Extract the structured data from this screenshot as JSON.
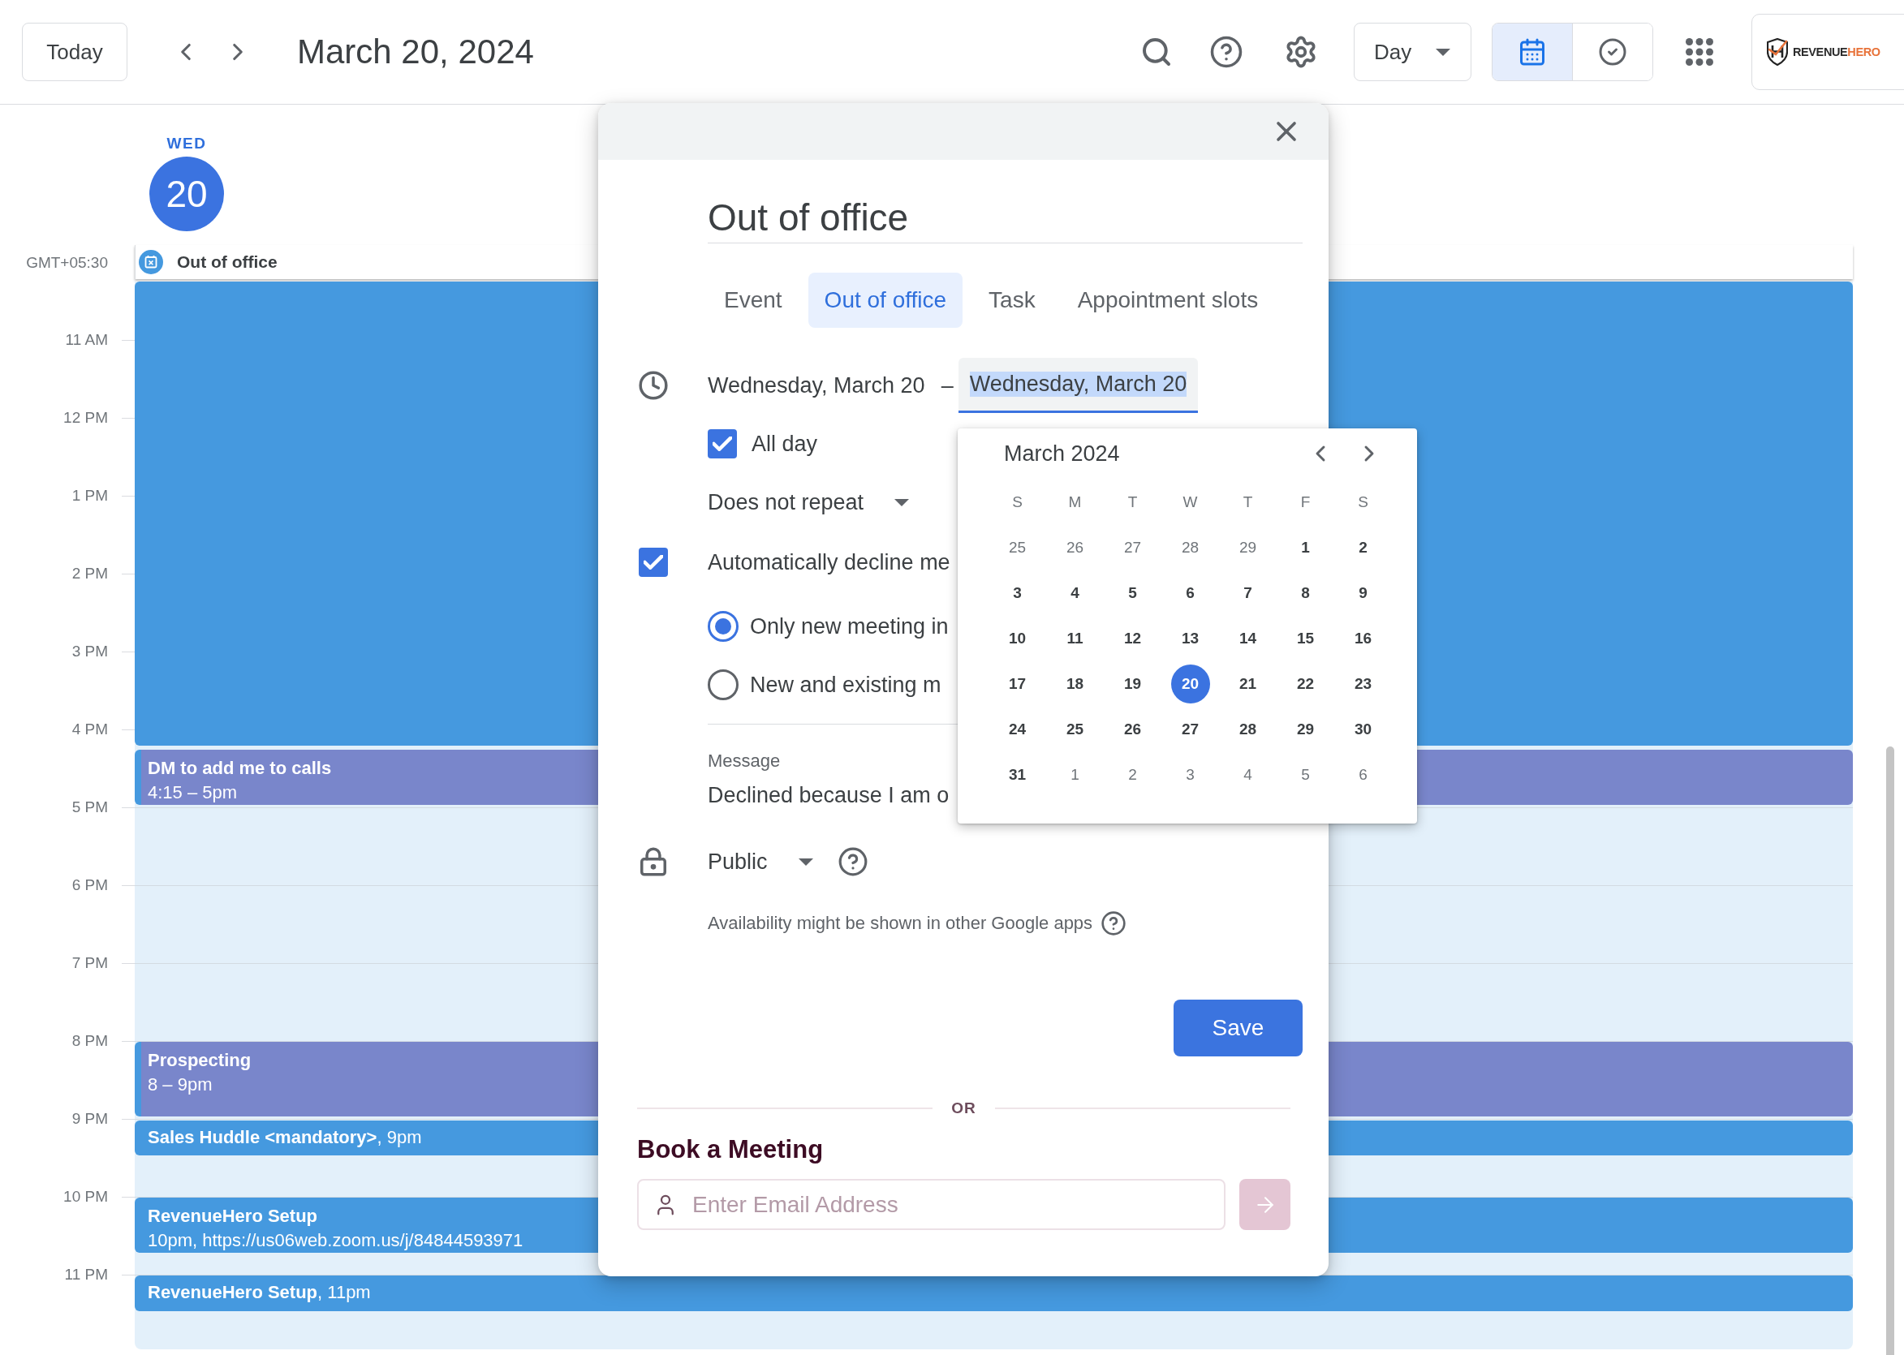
{
  "toolbar": {
    "today_button": "Today",
    "date_title": "March 20, 2024",
    "view_select": "Day",
    "view_toggle": [
      {
        "kind": "calendar",
        "selected": true
      },
      {
        "kind": "tasks",
        "selected": false
      }
    ],
    "logo": {
      "words": [
        {
          "text": "REVENUE",
          "color": "#2b2b2b"
        },
        {
          "text": "HERO",
          "color": "#e8733a"
        }
      ]
    }
  },
  "day_header": {
    "weekday": "WED",
    "date": "20",
    "today": true
  },
  "all_day": {
    "timezone": "GMT+05:30",
    "event": "Out of office"
  },
  "hours": [
    "11 AM",
    "12 PM",
    "1 PM",
    "2 PM",
    "3 PM",
    "4 PM",
    "5 PM",
    "6 PM",
    "7 PM",
    "8 PM",
    "9 PM",
    "10 PM",
    "11 PM"
  ],
  "events": [
    {
      "kind": "block",
      "color": "#4599df"
    },
    {
      "kind": "two_line",
      "title": "DM to add me to calls",
      "details": "4:15 – 5pm",
      "color": "#7986cb"
    },
    {
      "kind": "two_line",
      "title": "Prospecting",
      "details": "8 – 9pm",
      "color": "#7986cb"
    },
    {
      "kind": "one_line",
      "text": "**Sales Huddle <mandatory>**, 9pm",
      "color": "#4599df"
    },
    {
      "kind": "two_line",
      "title": "RevenueHero Setup",
      "details": "10pm, https://us06web.zoom.us/j/84844593971",
      "color": "#4599df"
    },
    {
      "kind": "one_line",
      "text": "**RevenueHero Setup**, 11pm",
      "color": "#4599df"
    }
  ],
  "dialog": {
    "title_field": "Out of office",
    "tabs": [
      {
        "label": "Event",
        "selected": false
      },
      {
        "label": "Out of office",
        "selected": true
      },
      {
        "label": "Task",
        "selected": false
      },
      {
        "label": "Appointment slots",
        "selected": false
      }
    ],
    "start_date": "Wednesday, March 20",
    "separator": "–",
    "end_date": {
      "value": "Wednesday, March 20",
      "focused": true
    },
    "all_day": {
      "label": "All day",
      "checked": true
    },
    "repeat": "Does not repeat",
    "auto_decline": {
      "label": "Automatically decline me",
      "checked": true
    },
    "decline_options": [
      {
        "label": "Only new meeting in",
        "selected": true
      },
      {
        "label": "New and existing m",
        "selected": false
      }
    ],
    "message": {
      "label": "Message",
      "value": "Declined because I am o"
    },
    "visibility": "Public",
    "availability_note": "Availability might be shown in other Google apps",
    "save_button": "Save",
    "divider_label": "OR",
    "booking": {
      "heading": "Book a Meeting",
      "email_placeholder": "Enter Email Address"
    }
  },
  "date_picker": {
    "title": "March 2024",
    "weekdays": [
      "S",
      "M",
      "T",
      "W",
      "T",
      "F",
      "S"
    ],
    "days": [
      {
        "label": "25",
        "in_month": false,
        "selected": false
      },
      {
        "label": "26",
        "in_month": false,
        "selected": false
      },
      {
        "label": "27",
        "in_month": false,
        "selected": false
      },
      {
        "label": "28",
        "in_month": false,
        "selected": false
      },
      {
        "label": "29",
        "in_month": false,
        "selected": false
      },
      {
        "label": "1",
        "in_month": true,
        "selected": false
      },
      {
        "label": "2",
        "in_month": true,
        "selected": false
      },
      {
        "label": "3",
        "in_month": true,
        "selected": false
      },
      {
        "label": "4",
        "in_month": true,
        "selected": false
      },
      {
        "label": "5",
        "in_month": true,
        "selected": false
      },
      {
        "label": "6",
        "in_month": true,
        "selected": false
      },
      {
        "label": "7",
        "in_month": true,
        "selected": false
      },
      {
        "label": "8",
        "in_month": true,
        "selected": false
      },
      {
        "label": "9",
        "in_month": true,
        "selected": false
      },
      {
        "label": "10",
        "in_month": true,
        "selected": false
      },
      {
        "label": "11",
        "in_month": true,
        "selected": false
      },
      {
        "label": "12",
        "in_month": true,
        "selected": false
      },
      {
        "label": "13",
        "in_month": true,
        "selected": false
      },
      {
        "label": "14",
        "in_month": true,
        "selected": false
      },
      {
        "label": "15",
        "in_month": true,
        "selected": false
      },
      {
        "label": "16",
        "in_month": true,
        "selected": false
      },
      {
        "label": "17",
        "in_month": true,
        "selected": false
      },
      {
        "label": "18",
        "in_month": true,
        "selected": false
      },
      {
        "label": "19",
        "in_month": true,
        "selected": false
      },
      {
        "label": "20",
        "in_month": true,
        "selected": true
      },
      {
        "label": "21",
        "in_month": true,
        "selected": false
      },
      {
        "label": "22",
        "in_month": true,
        "selected": false
      },
      {
        "label": "23",
        "in_month": true,
        "selected": false
      },
      {
        "label": "24",
        "in_month": true,
        "selected": false
      },
      {
        "label": "25",
        "in_month": true,
        "selected": false
      },
      {
        "label": "26",
        "in_month": true,
        "selected": false
      },
      {
        "label": "27",
        "in_month": true,
        "selected": false
      },
      {
        "label": "28",
        "in_month": true,
        "selected": false
      },
      {
        "label": "29",
        "in_month": true,
        "selected": false
      },
      {
        "label": "30",
        "in_month": true,
        "selected": false
      },
      {
        "label": "31",
        "in_month": true,
        "selected": false
      },
      {
        "label": "1",
        "in_month": false,
        "selected": false
      },
      {
        "label": "2",
        "in_month": false,
        "selected": false
      },
      {
        "label": "3",
        "in_month": false,
        "selected": false
      },
      {
        "label": "4",
        "in_month": false,
        "selected": false
      },
      {
        "label": "5",
        "in_month": false,
        "selected": false
      },
      {
        "label": "6",
        "in_month": false,
        "selected": false
      }
    ]
  }
}
